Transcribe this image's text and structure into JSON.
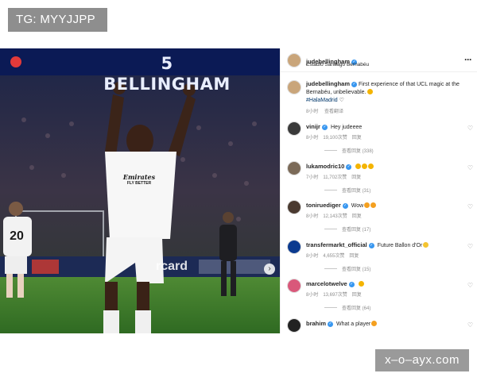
{
  "watermark_top": "TG: MYYJJPP",
  "watermark_bottom": "x–o–ayx.com",
  "photo": {
    "board_text": "5 BELLINGHAM",
    "shirt_sponsor_1": "Emirates",
    "shirt_sponsor_2": "FLY BETTER",
    "player_number": "20",
    "ad_text": "rcard"
  },
  "post_header": {
    "username": "judebellingham",
    "location": "Estadio Santiago Bernabéu"
  },
  "caption": {
    "username": "judebellingham",
    "text": "First experience of that UCL magic at the Bernabéu, unbelievable.",
    "hashtag": "#HalaMadrid",
    "time": "8小时",
    "see_translation": "查看翻译"
  },
  "comments": [
    {
      "username": "vinijr",
      "text": "Hey judeeee",
      "time": "8小时",
      "likes": "19,100次赞",
      "reply": "回复",
      "view_replies": "查看回复 (338)",
      "avatar_color": "#3a3a3a"
    },
    {
      "username": "lukamodric10",
      "text": "",
      "emojis": [
        "#f4b400",
        "#f4b400",
        "#f4b400"
      ],
      "time": "7小时",
      "likes": "11,702次赞",
      "reply": "回复",
      "view_replies": "查看回复 (31)",
      "avatar_color": "#7b6a58"
    },
    {
      "username": "toniruediger",
      "text": "Wow",
      "emojis": [
        "#f4a020",
        "#f4a020"
      ],
      "time": "8小时",
      "likes": "12,143次赞",
      "reply": "回复",
      "view_replies": "查看回复 (17)",
      "avatar_color": "#4a3a30"
    },
    {
      "username": "transfermarkt_official",
      "text": "Future Ballon d'Or",
      "emojis": [
        "#f4c430"
      ],
      "time": "8小时",
      "likes": "4,655次赞",
      "reply": "回复",
      "view_replies": "查看回复 (15)",
      "avatar_color": "#0b3a8f"
    },
    {
      "username": "marcelotwelve",
      "text": "",
      "emojis": [
        "#f4b400"
      ],
      "time": "8小时",
      "likes": "13,697次赞",
      "reply": "回复",
      "view_replies": "查看回复 (64)",
      "avatar_color": "#d9587a"
    },
    {
      "username": "brahim",
      "text": "What a player",
      "emojis": [
        "#f4a020"
      ],
      "time": "",
      "likes": "",
      "reply": "",
      "view_replies": "",
      "avatar_color": "#222222"
    }
  ]
}
